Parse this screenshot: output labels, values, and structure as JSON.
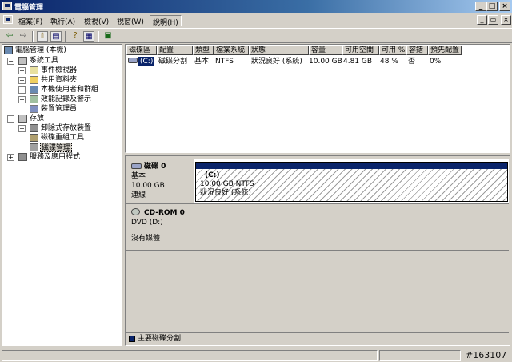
{
  "window": {
    "title": "電腦管理",
    "minimize": "_",
    "maximize": "□",
    "close": "×"
  },
  "menu": {
    "items": [
      {
        "label": "檔案(F)",
        "mnemonic": "F"
      },
      {
        "label": "執行(A)",
        "mnemonic": "A"
      },
      {
        "label": "檢視(V)",
        "mnemonic": "V"
      },
      {
        "label": "視窗(W)",
        "mnemonic": "W"
      },
      {
        "label": "說明(H)",
        "mnemonic": "H"
      }
    ]
  },
  "toolbar": {
    "buttons": [
      "back",
      "forward",
      "up",
      "show-hide-tree",
      "properties",
      "help",
      "export"
    ]
  },
  "tree": {
    "root": "電腦管理 (本機)",
    "system_tools": "系統工具",
    "event_viewer": "事件檢視器",
    "shared_folders": "共用資料夾",
    "local_users": "本機使用者和群組",
    "perf_logs": "效能記錄及警示",
    "device_manager": "裝置管理員",
    "storage": "存放",
    "removable_storage": "卸除式存放裝置",
    "defrag": "磁碟重組工具",
    "disk_mgmt": "磁碟管理",
    "services_apps": "服務及應用程式",
    "expander_plus": "+",
    "expander_minus": "−"
  },
  "volume_list": {
    "columns": [
      "磁碟區",
      "配置",
      "類型",
      "檔案系統",
      "狀態",
      "容量",
      "可用空間",
      "可用 %",
      "容錯",
      "預先配置"
    ],
    "rows": [
      {
        "volume": "(C:)",
        "layout": "磁碟分割",
        "type": "基本",
        "fs": "NTFS",
        "status": "狀況良好 (系統)",
        "capacity": "10.00 GB",
        "free": "4.81 GB",
        "free_pct": "48 %",
        "fault_tolerance": "否",
        "overhead": "0%"
      }
    ]
  },
  "disks": [
    {
      "name": "磁碟 0",
      "type": "基本",
      "size": "10.00 GB",
      "status": "連線",
      "partition": {
        "label": "(C:)",
        "size_fs": "10.00 GB NTFS",
        "status": "狀況良好 (系統)"
      }
    },
    {
      "name": "CD-ROM 0",
      "type": "DVD (D:)",
      "status": "沒有媒體"
    }
  ],
  "legend": {
    "label": "主要磁碟分割",
    "color": "#0a246a"
  },
  "status_bar": {
    "text": "",
    "watermark": "#163107"
  }
}
